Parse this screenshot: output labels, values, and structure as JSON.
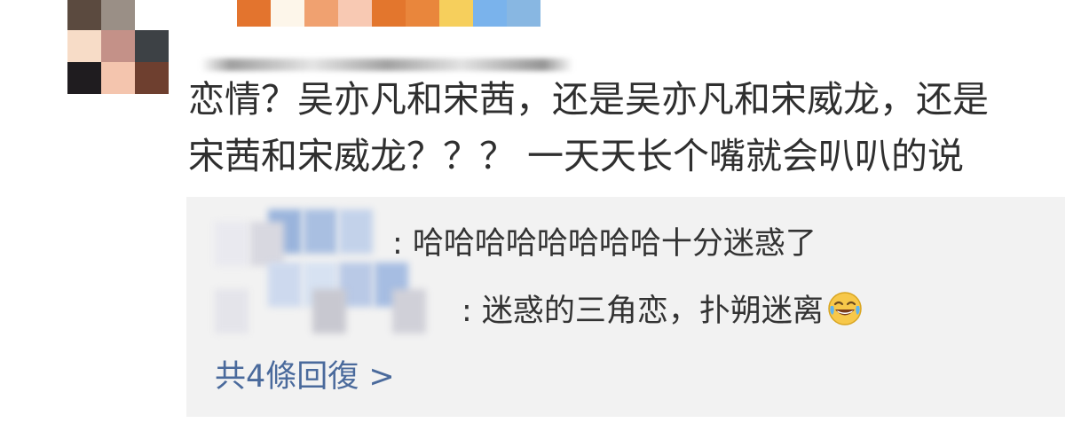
{
  "comment": {
    "lines": [
      "恋情？吴亦凡和宋茜，还是吴亦凡和宋威龙，还是",
      "宋茜和宋威龙？？？ 一天天长个嘴就会叭叭的说"
    ],
    "avatar_colors": [
      "#5b4a3f",
      "#9a8f86",
      "#ffffff",
      "#f7dcc7",
      "#c49188",
      "#3d4145",
      "#1f1c1f",
      "#f4c5ae",
      "#6e3f2f"
    ],
    "name_colors": [
      "#e3742e",
      "#fdf6ea",
      "#f0a170",
      "#f8c9b3",
      "#e3762d",
      "#e9863c",
      "#f6cf5c",
      "#7ab3ec",
      "#88b7e2"
    ]
  },
  "replies": [
    {
      "body": ": 哈哈哈哈哈哈哈哈十分迷惑了"
    },
    {
      "body": ": 迷惑的三角恋，扑朔迷离",
      "emoji": "laughing-tears-emoji"
    }
  ],
  "more_link": "共4條回復 >",
  "colors": {
    "link": "#4a6a9c",
    "reply_bg": "#f2f2f2",
    "text": "#333333"
  }
}
